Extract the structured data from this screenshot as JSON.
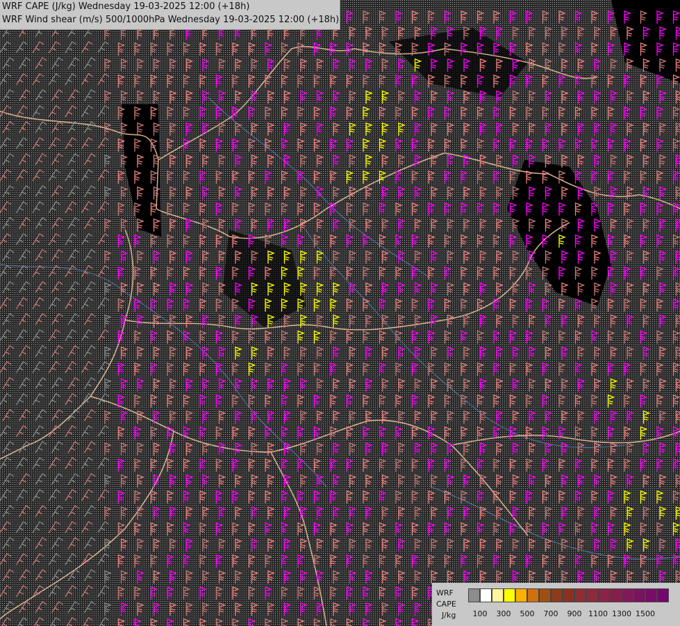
{
  "title": {
    "line1": "WRF CAPE (J/kg) Wednesday 19-03-2025 12:00 (+18h)",
    "line2": "WRF Wind shear (m/s) 500/1000hPa Wednesday 19-03-2025 12:00 (+18h)"
  },
  "legend": {
    "label_model": "WRF",
    "label_field": "CAPE",
    "label_unit": "J/kg",
    "swatch_colors": [
      "#8c8c8c",
      "#ffffff",
      "#fff59a",
      "#ffff00",
      "#ffb000",
      "#d07010",
      "#a05014",
      "#8c3c1a",
      "#8a3222",
      "#8e2e34",
      "#8e2a3c",
      "#8a2444",
      "#861e4c",
      "#821858",
      "#7c1260",
      "#780c68",
      "#74066e"
    ],
    "ticks": [
      "100",
      "300",
      "500",
      "700",
      "900",
      "1100",
      "1300",
      "1500"
    ]
  },
  "colors": {
    "background": "#000000",
    "barb_magenta": "#ff00ff",
    "barb_salmon": "#f08080",
    "barb_rose": "#c87878",
    "barb_yellow": "#ffff00",
    "border": "#f0c8a0",
    "river": "#5a8ac8"
  },
  "icons": [
    "wind-barb-icon"
  ]
}
